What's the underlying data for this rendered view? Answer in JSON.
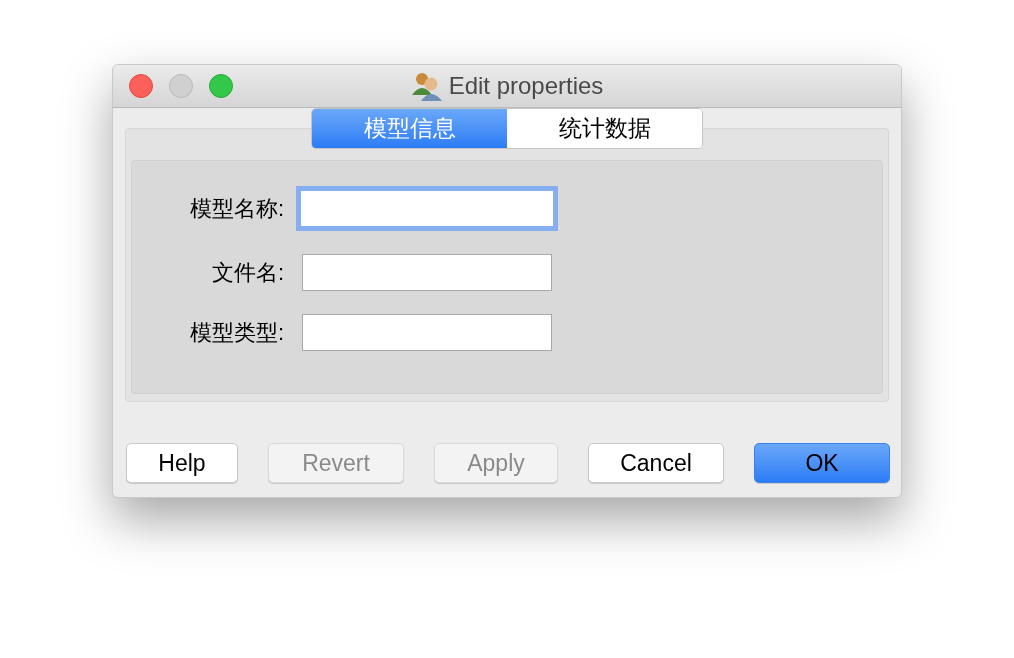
{
  "window": {
    "title": "Edit properties"
  },
  "tabs": [
    {
      "label": "模型信息",
      "selected": true
    },
    {
      "label": "统计数据",
      "selected": false
    }
  ],
  "fields": [
    {
      "label": "模型名称:",
      "focused": true
    },
    {
      "label": "文件名:",
      "focused": false
    },
    {
      "label": "模型类型:",
      "focused": false
    }
  ],
  "buttons": [
    {
      "label": "Help",
      "kind": "normal",
      "disabled": false
    },
    {
      "label": "Revert",
      "kind": "normal",
      "disabled": true
    },
    {
      "label": "Apply",
      "kind": "normal",
      "disabled": true
    },
    {
      "label": "Cancel",
      "kind": "normal",
      "disabled": false
    },
    {
      "label": "OK",
      "kind": "primary",
      "disabled": false
    }
  ]
}
